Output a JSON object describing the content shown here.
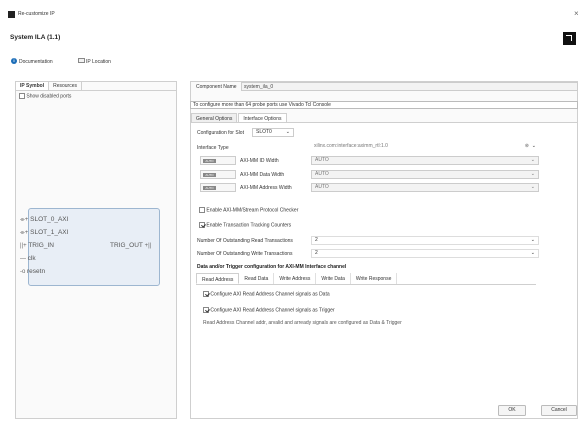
{
  "window": {
    "title": "Re-customize IP",
    "close_glyph": "×"
  },
  "header": {
    "ip_name": "System ILA (1.1)",
    "brand_icon": "amd-logo-icon"
  },
  "links": {
    "documentation": "Documentation",
    "ip_location": "IP Location"
  },
  "left_panel": {
    "tabs": [
      "IP Symbol",
      "Resources"
    ],
    "show_disabled_ports": "Show disabled ports",
    "ports_left": [
      "SLOT_0_AXI",
      "SLOT_1_AXI",
      "TRIG_IN",
      "clk",
      "resetn"
    ],
    "port_right": "TRIG_OUT"
  },
  "component": {
    "label": "Component Name",
    "value": "system_ila_0"
  },
  "info": "To configure more than 64 probe ports use Vivado Tcl Console",
  "tabs": [
    "General Options",
    "Interface Options"
  ],
  "interface_options": {
    "slot_label": "Configuration for Slot",
    "slot_value": "SLOT0",
    "interface_type_label": "Interface Type",
    "interface_type_value": "xilinx.com:interface:aximm_rtl:1.0",
    "auto_label": "AUTO",
    "widths": [
      {
        "label": "AXI-MM ID Width",
        "value": "AUTO"
      },
      {
        "label": "AXI-MM Data Width",
        "value": "AUTO"
      },
      {
        "label": "AXI-MM Address Width",
        "value": "AUTO"
      }
    ],
    "protocol_checker": "Enable AXI-MM/Stream Protocol Checker",
    "tracking_counters": "Enable Transaction Tracking Counters",
    "outstanding_reads_label": "Number Of Outstanding Read Transactions",
    "outstanding_reads_value": "2",
    "outstanding_writes_label": "Number Of Outstanding Write Transactions",
    "outstanding_writes_value": "2",
    "section_title": "Data and/or Trigger configuration for AXI-MM Interface channel",
    "channel_tabs": [
      "Read Address",
      "Read Data",
      "Write Address",
      "Write Data",
      "Write Response"
    ],
    "configure_data": "Configure AXI Read Address Channel signals as Data",
    "configure_trigger": "Configure AXI Read Address Channel signals as Trigger",
    "note": "Read Address Channel addr, arvalid and arready signals are configured as Data & Trigger"
  },
  "buttons": {
    "ok": "OK",
    "cancel": "Cancel"
  }
}
